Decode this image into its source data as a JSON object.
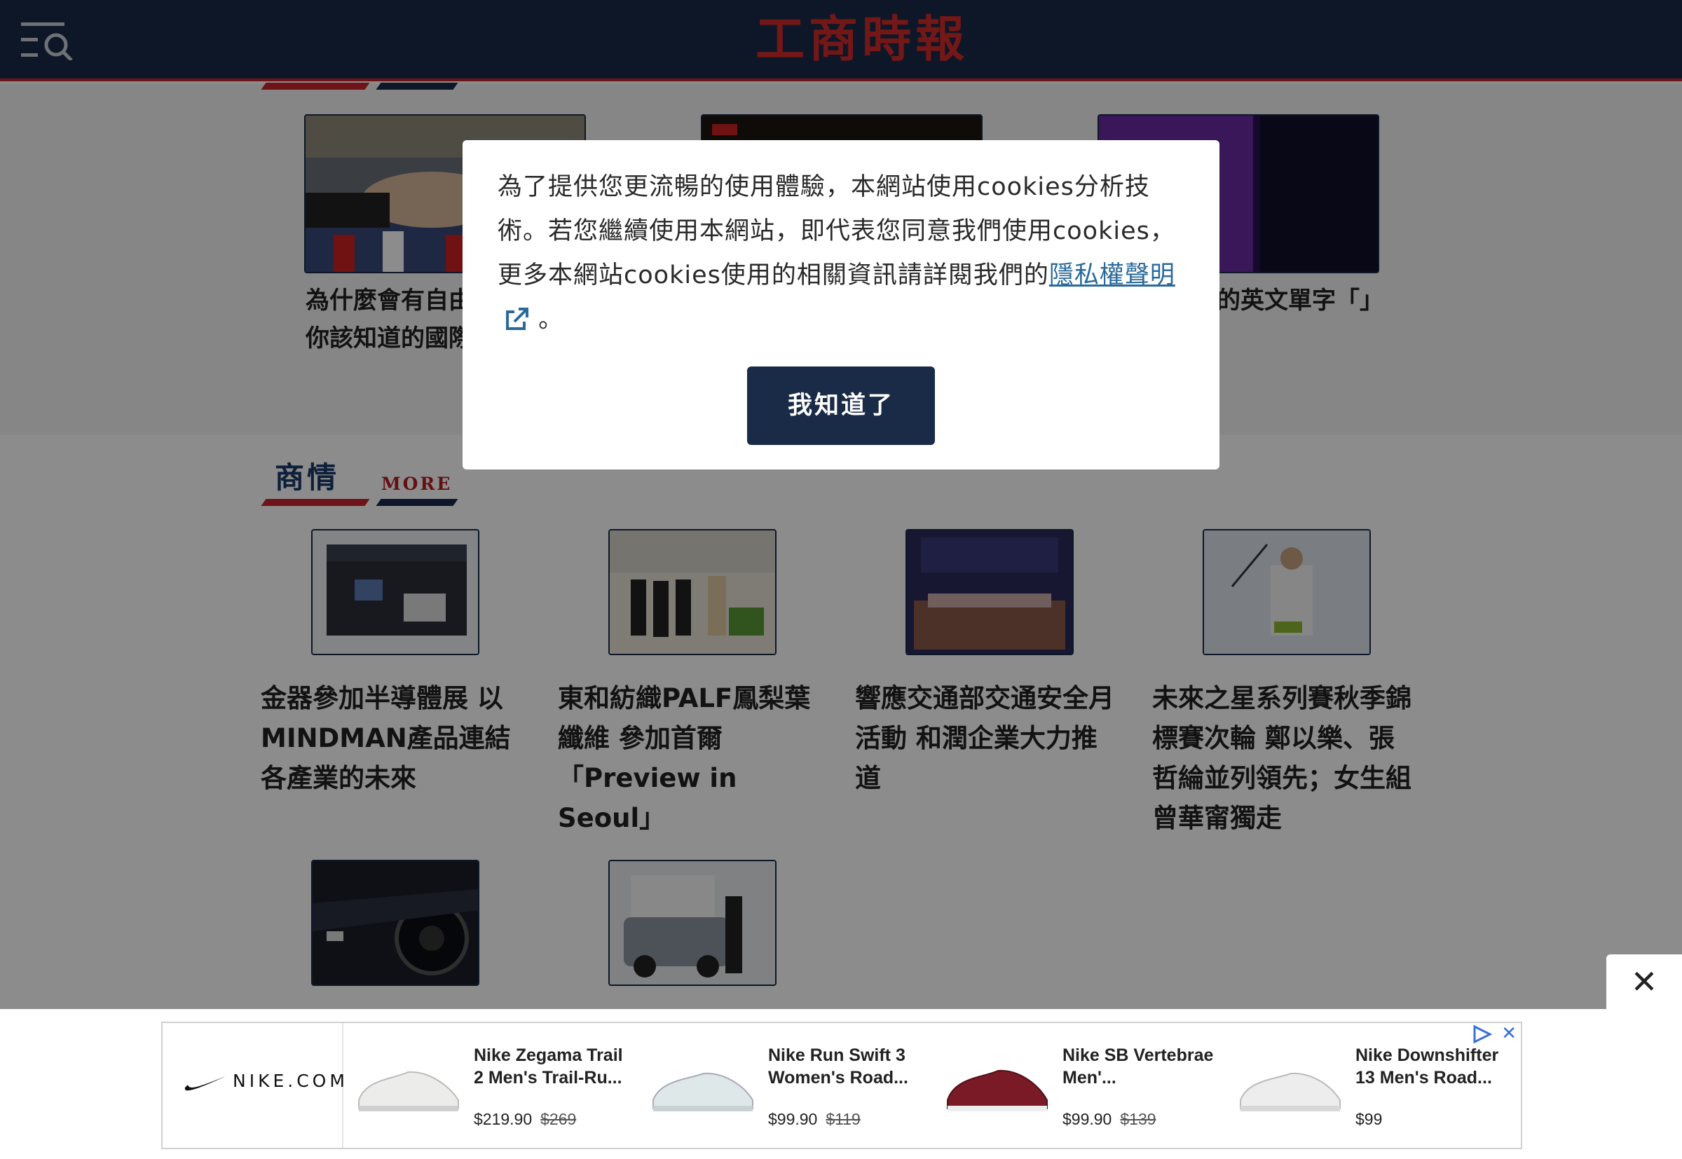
{
  "header": {
    "logo": "工商時報"
  },
  "top_articles": [
    {
      "title": "為什麼會有自由貿易協定？你該知道的國際貿易知識"
    },
    {
      "title": ""
    },
    {
      "title": "跟商業有關的英文單字「」是什麼意思"
    }
  ],
  "section": {
    "title": "商情",
    "more": "MORE"
  },
  "cards": [
    {
      "title": "金器參加半導體展 以MINDMAN產品連結各產業的未來"
    },
    {
      "title": "東和紡織PALF鳳梨葉纖維 參加首爾「Preview in Seoul」"
    },
    {
      "title": "響應交通部交通安全月活動 和潤企業大力推道"
    },
    {
      "title": "未來之星系列賽秋季錦標賽次輪 鄭以樂、張哲綸並列領先；女生組曾華甯獨走"
    }
  ],
  "cookie_modal": {
    "text_before": "為了提供您更流暢的使用體驗，本網站使用cookies分析技術。若您繼續使用本網站，即代表您同意我們使用cookies，更多本網站cookies使用的相關資訊請詳閱我們的",
    "link_text": "隱私權聲明",
    "text_after": "。",
    "button_label": "我知道了"
  },
  "ad": {
    "close_label": "✕",
    "brand": "NIKE.COM",
    "products": [
      {
        "name": "Nike Zegama Trail 2 Men's Trail-Ru...",
        "price": "$219.90",
        "old_price": "$269",
        "color": "#ececea"
      },
      {
        "name": "Nike Run Swift 3 Women's Road...",
        "price": "$99.90",
        "old_price": "$119",
        "color": "#dfe8e8"
      },
      {
        "name": "Nike SB Vertebrae Men'...",
        "price": "$99.90",
        "old_price": "$139",
        "color": "#7a1a26"
      },
      {
        "name": "Nike Downshifter 13 Men's Road...",
        "price": "$99",
        "old_price": "",
        "color": "#ededed"
      }
    ]
  },
  "colors": {
    "navy": "#1a2b47",
    "red": "#c8242a",
    "link": "#2a6a9a"
  }
}
